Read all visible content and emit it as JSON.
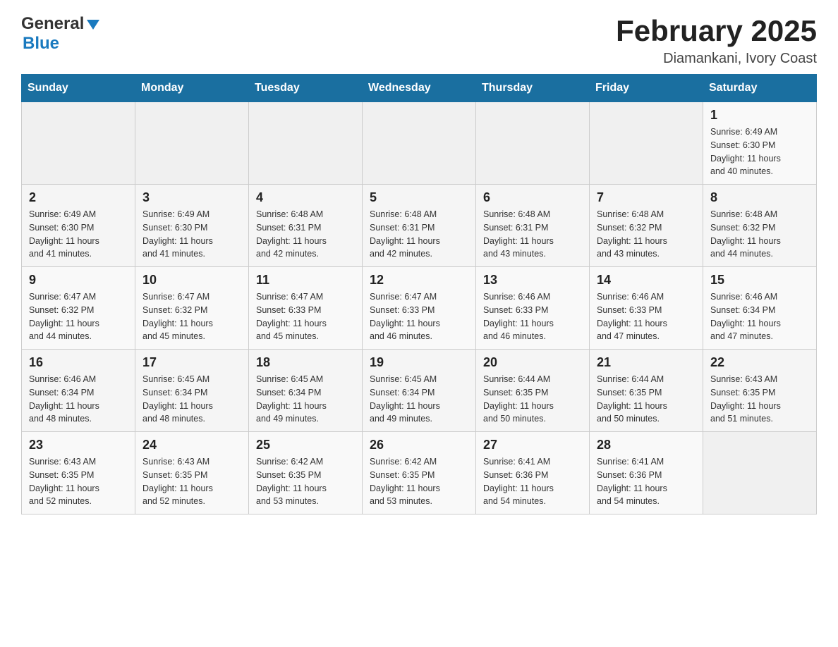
{
  "header": {
    "logo_general": "General",
    "logo_blue": "Blue",
    "title": "February 2025",
    "location": "Diamankani, Ivory Coast"
  },
  "days_header": [
    "Sunday",
    "Monday",
    "Tuesday",
    "Wednesday",
    "Thursday",
    "Friday",
    "Saturday"
  ],
  "weeks": [
    {
      "shade": false,
      "days": [
        {
          "num": "",
          "info": ""
        },
        {
          "num": "",
          "info": ""
        },
        {
          "num": "",
          "info": ""
        },
        {
          "num": "",
          "info": ""
        },
        {
          "num": "",
          "info": ""
        },
        {
          "num": "",
          "info": ""
        },
        {
          "num": "1",
          "info": "Sunrise: 6:49 AM\nSunset: 6:30 PM\nDaylight: 11 hours\nand 40 minutes."
        }
      ]
    },
    {
      "shade": true,
      "days": [
        {
          "num": "2",
          "info": "Sunrise: 6:49 AM\nSunset: 6:30 PM\nDaylight: 11 hours\nand 41 minutes."
        },
        {
          "num": "3",
          "info": "Sunrise: 6:49 AM\nSunset: 6:30 PM\nDaylight: 11 hours\nand 41 minutes."
        },
        {
          "num": "4",
          "info": "Sunrise: 6:48 AM\nSunset: 6:31 PM\nDaylight: 11 hours\nand 42 minutes."
        },
        {
          "num": "5",
          "info": "Sunrise: 6:48 AM\nSunset: 6:31 PM\nDaylight: 11 hours\nand 42 minutes."
        },
        {
          "num": "6",
          "info": "Sunrise: 6:48 AM\nSunset: 6:31 PM\nDaylight: 11 hours\nand 43 minutes."
        },
        {
          "num": "7",
          "info": "Sunrise: 6:48 AM\nSunset: 6:32 PM\nDaylight: 11 hours\nand 43 minutes."
        },
        {
          "num": "8",
          "info": "Sunrise: 6:48 AM\nSunset: 6:32 PM\nDaylight: 11 hours\nand 44 minutes."
        }
      ]
    },
    {
      "shade": false,
      "days": [
        {
          "num": "9",
          "info": "Sunrise: 6:47 AM\nSunset: 6:32 PM\nDaylight: 11 hours\nand 44 minutes."
        },
        {
          "num": "10",
          "info": "Sunrise: 6:47 AM\nSunset: 6:32 PM\nDaylight: 11 hours\nand 45 minutes."
        },
        {
          "num": "11",
          "info": "Sunrise: 6:47 AM\nSunset: 6:33 PM\nDaylight: 11 hours\nand 45 minutes."
        },
        {
          "num": "12",
          "info": "Sunrise: 6:47 AM\nSunset: 6:33 PM\nDaylight: 11 hours\nand 46 minutes."
        },
        {
          "num": "13",
          "info": "Sunrise: 6:46 AM\nSunset: 6:33 PM\nDaylight: 11 hours\nand 46 minutes."
        },
        {
          "num": "14",
          "info": "Sunrise: 6:46 AM\nSunset: 6:33 PM\nDaylight: 11 hours\nand 47 minutes."
        },
        {
          "num": "15",
          "info": "Sunrise: 6:46 AM\nSunset: 6:34 PM\nDaylight: 11 hours\nand 47 minutes."
        }
      ]
    },
    {
      "shade": true,
      "days": [
        {
          "num": "16",
          "info": "Sunrise: 6:46 AM\nSunset: 6:34 PM\nDaylight: 11 hours\nand 48 minutes."
        },
        {
          "num": "17",
          "info": "Sunrise: 6:45 AM\nSunset: 6:34 PM\nDaylight: 11 hours\nand 48 minutes."
        },
        {
          "num": "18",
          "info": "Sunrise: 6:45 AM\nSunset: 6:34 PM\nDaylight: 11 hours\nand 49 minutes."
        },
        {
          "num": "19",
          "info": "Sunrise: 6:45 AM\nSunset: 6:34 PM\nDaylight: 11 hours\nand 49 minutes."
        },
        {
          "num": "20",
          "info": "Sunrise: 6:44 AM\nSunset: 6:35 PM\nDaylight: 11 hours\nand 50 minutes."
        },
        {
          "num": "21",
          "info": "Sunrise: 6:44 AM\nSunset: 6:35 PM\nDaylight: 11 hours\nand 50 minutes."
        },
        {
          "num": "22",
          "info": "Sunrise: 6:43 AM\nSunset: 6:35 PM\nDaylight: 11 hours\nand 51 minutes."
        }
      ]
    },
    {
      "shade": false,
      "days": [
        {
          "num": "23",
          "info": "Sunrise: 6:43 AM\nSunset: 6:35 PM\nDaylight: 11 hours\nand 52 minutes."
        },
        {
          "num": "24",
          "info": "Sunrise: 6:43 AM\nSunset: 6:35 PM\nDaylight: 11 hours\nand 52 minutes."
        },
        {
          "num": "25",
          "info": "Sunrise: 6:42 AM\nSunset: 6:35 PM\nDaylight: 11 hours\nand 53 minutes."
        },
        {
          "num": "26",
          "info": "Sunrise: 6:42 AM\nSunset: 6:35 PM\nDaylight: 11 hours\nand 53 minutes."
        },
        {
          "num": "27",
          "info": "Sunrise: 6:41 AM\nSunset: 6:36 PM\nDaylight: 11 hours\nand 54 minutes."
        },
        {
          "num": "28",
          "info": "Sunrise: 6:41 AM\nSunset: 6:36 PM\nDaylight: 11 hours\nand 54 minutes."
        },
        {
          "num": "",
          "info": ""
        }
      ]
    }
  ]
}
